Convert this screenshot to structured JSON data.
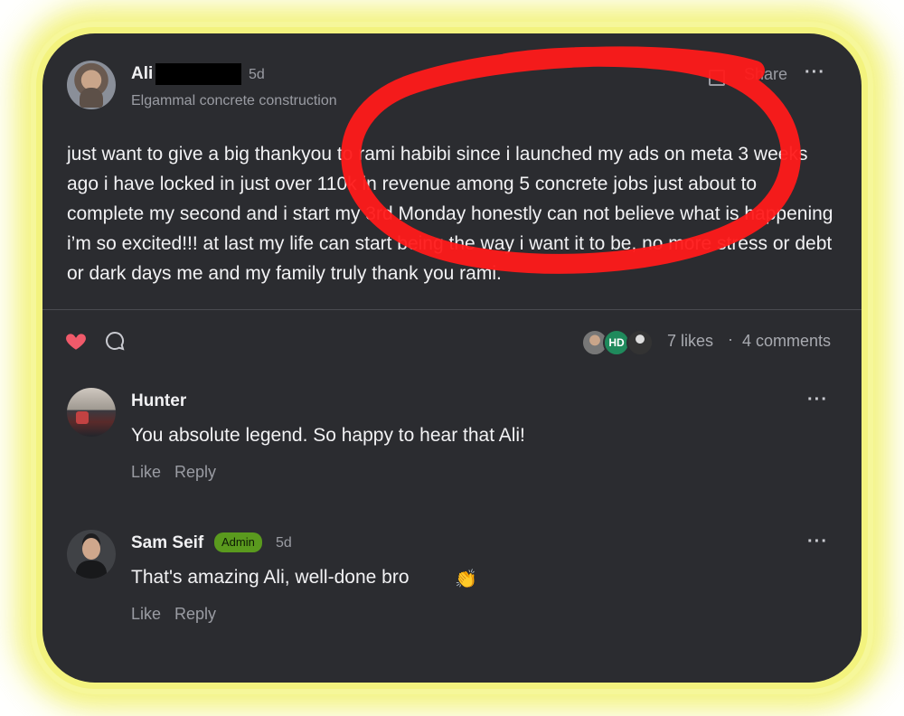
{
  "post": {
    "author": "Ali",
    "time": "5d",
    "subtitle": "Elgammal concrete construction",
    "share_label": "Share",
    "more_label": "···",
    "body": "just want to give a big thankyou to rami habibi since i launched my ads on meta 3 weeks ago i have locked in just over 110k in revenue among 5 concrete jobs just about to complete my second and i start my 3rd Monday honestly can not believe what is happening i’m so excited!!! at last my life can start being the way i want it to be, no more stress or debt or dark days me and my family truly thank you rami."
  },
  "stats": {
    "avatar_initials": "HD",
    "likes": "7 likes",
    "separator": "·",
    "comments": "4 comments"
  },
  "comments": [
    {
      "author": "Hunter",
      "text": "You absolute legend. So happy to hear that Ali!",
      "like_label": "Like",
      "reply_label": "Reply",
      "more_label": "···"
    },
    {
      "author": "Sam Seif",
      "badge": "Admin",
      "time": "5d",
      "text": "That's amazing Ali, well-done bro",
      "emoji": "👏",
      "like_label": "Like",
      "reply_label": "Reply",
      "more_label": "···"
    }
  ],
  "colors": {
    "card_bg": "#2b2c30",
    "glow": "#f3f37e",
    "circle_annotation": "#ff1a1a",
    "heart": "#f05a6a",
    "admin_badge": "#5a9a1e"
  },
  "icons": [
    "heart-icon",
    "comment-icon",
    "share-icon",
    "more-icon",
    "clap-emoji"
  ]
}
